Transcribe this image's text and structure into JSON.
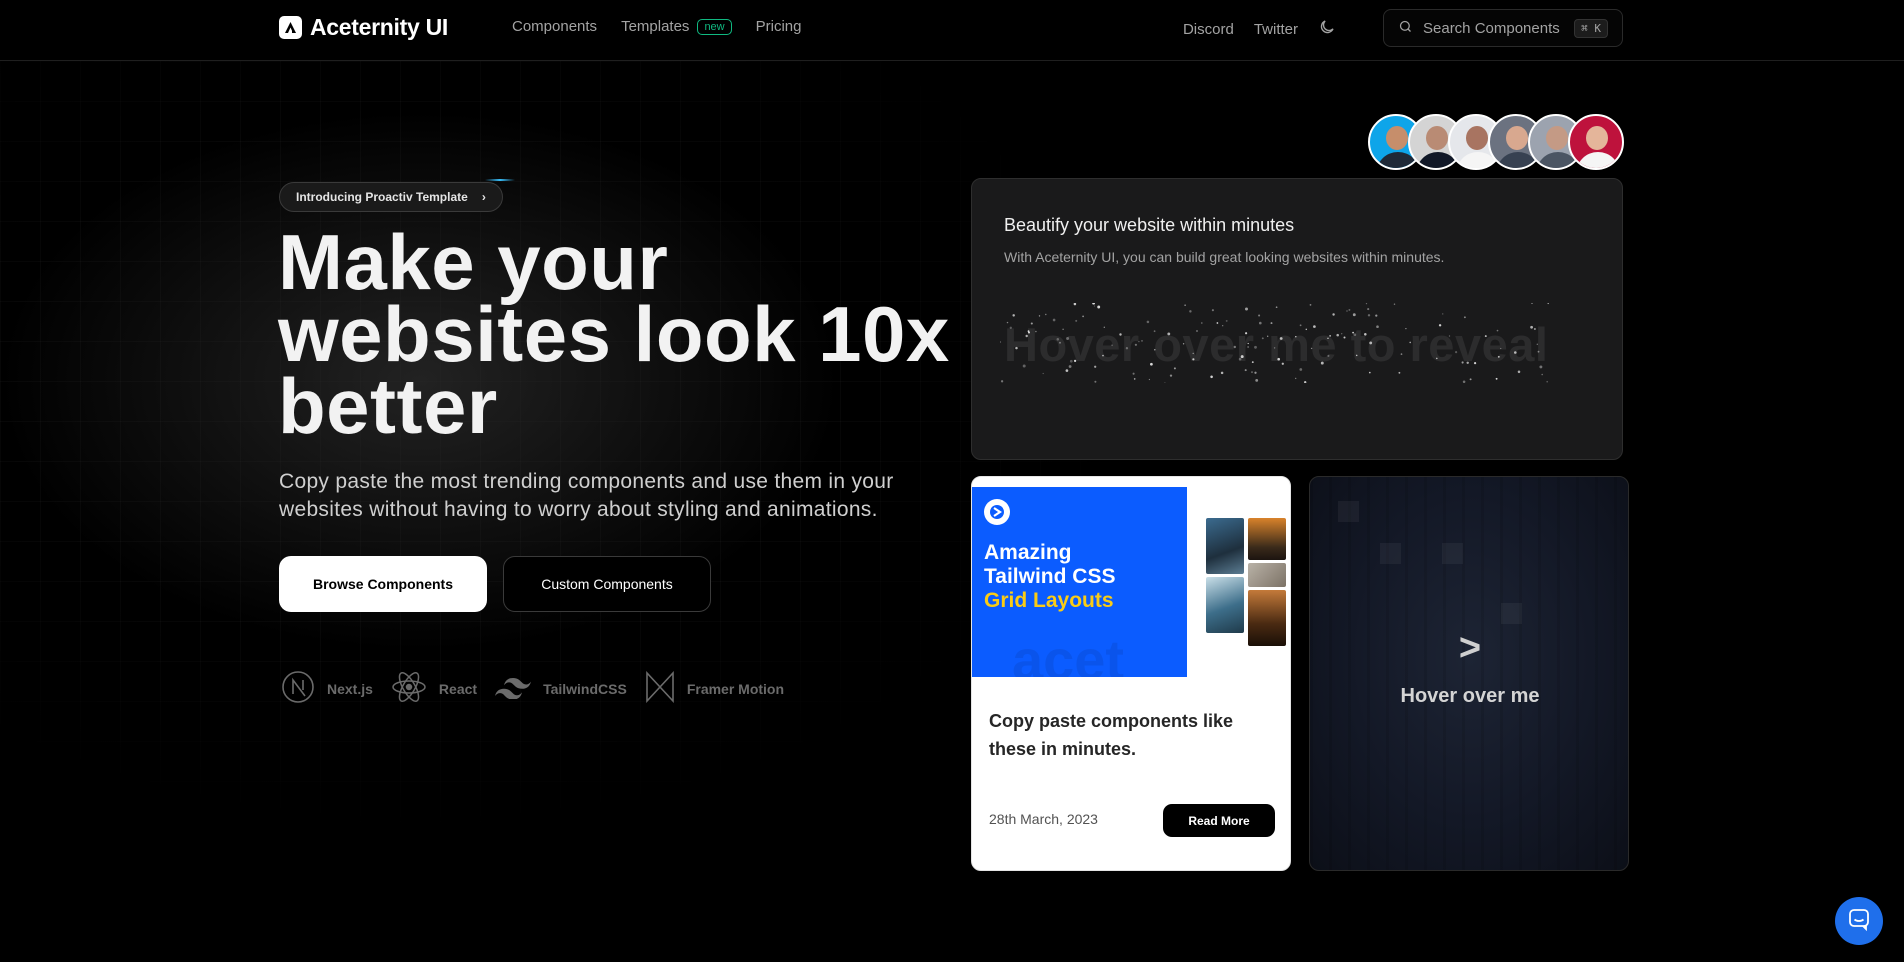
{
  "nav": {
    "brand": "Aceternity UI",
    "links": [
      {
        "label": "Components"
      },
      {
        "label": "Templates",
        "badge": "new"
      },
      {
        "label": "Pricing"
      }
    ],
    "right_links": [
      {
        "label": "Discord"
      },
      {
        "label": "Twitter"
      }
    ],
    "search": {
      "placeholder": "Search Components",
      "shortcut": "⌘ K"
    }
  },
  "hero": {
    "announcement": "Introducing Proactiv Template",
    "announcement_chevron": "›",
    "title": "Make your websites look 10x better",
    "subtitle": "Copy paste the most trending components and use them in your websites without having to worry about styling and animations.",
    "primary_cta": "Browse Components",
    "secondary_cta": "Custom Components",
    "tech": [
      {
        "name": "Next.js",
        "icon": "nextjs-icon"
      },
      {
        "name": "React",
        "icon": "react-icon"
      },
      {
        "name": "TailwindCSS",
        "icon": "tailwind-icon"
      },
      {
        "name": "Framer Motion",
        "icon": "framer-motion-icon"
      }
    ]
  },
  "avatars": [
    {
      "bg": "#0ea5e9",
      "skin": "#c68e6b",
      "shirt": "#1f2937"
    },
    {
      "bg": "#d4d4d4",
      "skin": "#b98b74",
      "shirt": "#111827"
    },
    {
      "bg": "#e5e7eb",
      "skin": "#a87461",
      "shirt": "#f5f5f5"
    },
    {
      "bg": "#6b7280",
      "skin": "#d8a88f",
      "shirt": "#374151"
    },
    {
      "bg": "#9ca3af",
      "skin": "#c49a85",
      "shirt": "#4b5563"
    },
    {
      "bg": "#be123c",
      "skin": "#e4b59a",
      "shirt": "#f5f5f5"
    }
  ],
  "reveal_card": {
    "title": "Beautify your website within minutes",
    "description": "With Aceternity UI, you can build great looking websites within minutes.",
    "reveal_text": "Hover over me to reveal"
  },
  "blog_card": {
    "image_title_1": "Amazing",
    "image_title_2": "Tailwind CSS",
    "image_title_3": "Grid Layouts",
    "image_ghost": "acet",
    "headline": "Copy paste components like these in minutes.",
    "date": "28th March, 2023",
    "cta": "Read More"
  },
  "hover_card": {
    "arrow": ">",
    "label": "Hover over me"
  },
  "colors": {
    "accent_blue": "#0b5cff",
    "accent_yellow": "#facc15",
    "badge_green": "#10b981",
    "chat_blue": "#1f6feb"
  }
}
